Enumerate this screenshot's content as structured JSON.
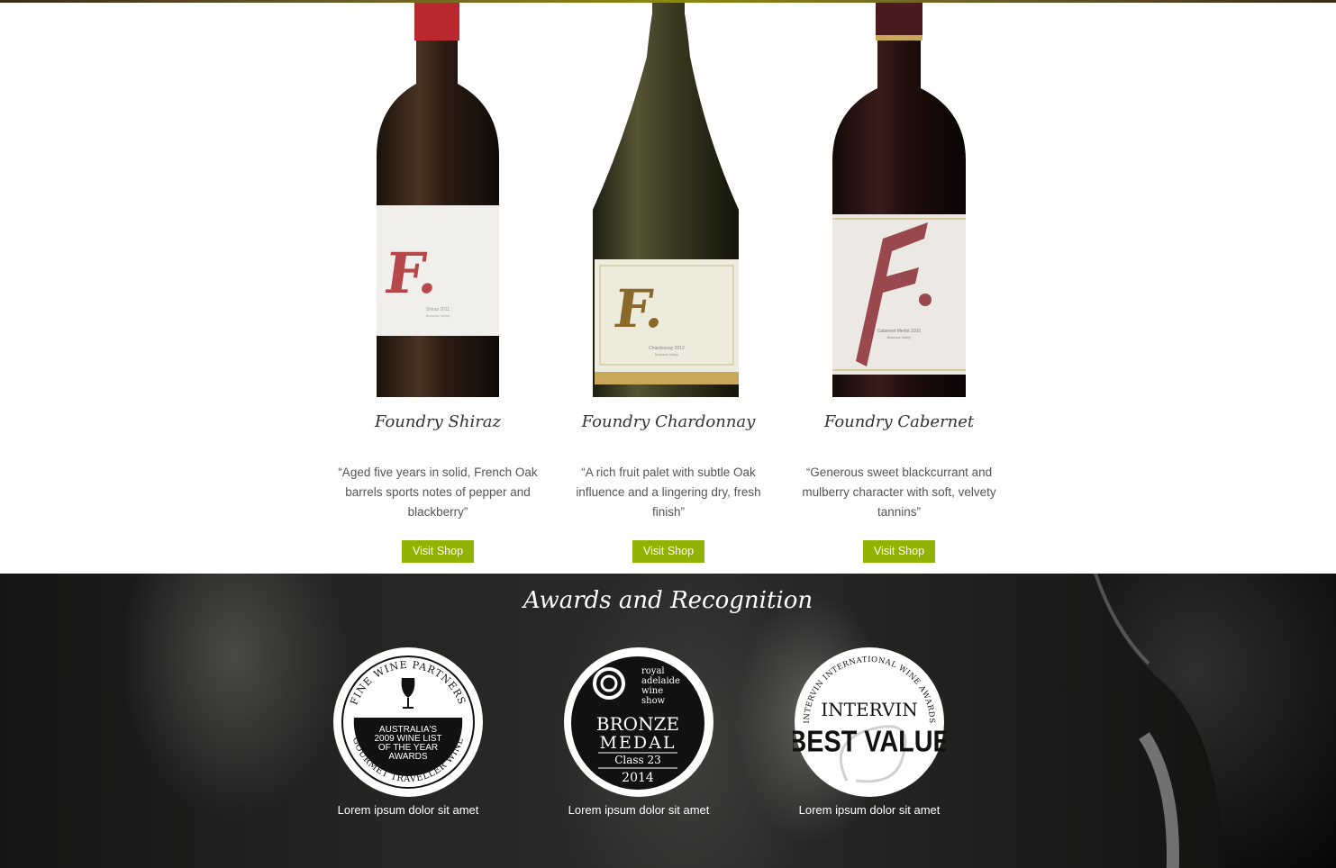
{
  "products": [
    {
      "name": "Foundry Shiraz",
      "description": "“Aged five years in solid, French Oak barrels sports notes of pepper and blackberry”",
      "button": "Visit Shop",
      "label_text": "Shiraz 2011",
      "label_sub": "Barossa Valley"
    },
    {
      "name": "Foundry Chardonnay",
      "description": "“A rich fruit palet with subtle Oak influence and a lingering dry, fresh finish”",
      "button": "Visit Shop",
      "label_text": "Chardonnay 2012",
      "label_sub": "Barossa Valley"
    },
    {
      "name": "Foundry Cabernet",
      "description": "“Generous sweet blackcurrant and mulberry character with soft, velvety tannins”",
      "button": "Visit Shop",
      "label_text": "Cabernet Merlot 2010",
      "label_sub": "Barossa Valley"
    }
  ],
  "awards": {
    "title": "Awards and Recognition",
    "items": [
      {
        "top_arc": "FINE WINE PARTNERS",
        "bottom_arc": "GOURMET TRAVELLER WINE",
        "lines": [
          "AUSTRALIA'S",
          "2009 WINE LIST",
          "OF THE YEAR",
          "AWARDS"
        ],
        "caption": "Lorem ipsum dolor sit amet"
      },
      {
        "brand_lines": [
          "royal",
          "adelaide",
          "wine",
          "show"
        ],
        "medal": "BRONZE",
        "medal2": "MEDAL",
        "class": "Class 23",
        "year": "2014",
        "caption": "Lorem ipsum dolor sit amet"
      },
      {
        "top_arc": "INTERVIN INTERNATIONAL WINE AWARDS",
        "brand": "INTERVIN",
        "value": "BEST VALUE",
        "caption": "Lorem ipsum dolor sit amet"
      }
    ]
  },
  "colors": {
    "button": "#8fb300",
    "shiraz_f": "#b8474a",
    "chardonnay_f": "#8a6a2a",
    "cabernet_f": "#8b2b33"
  }
}
